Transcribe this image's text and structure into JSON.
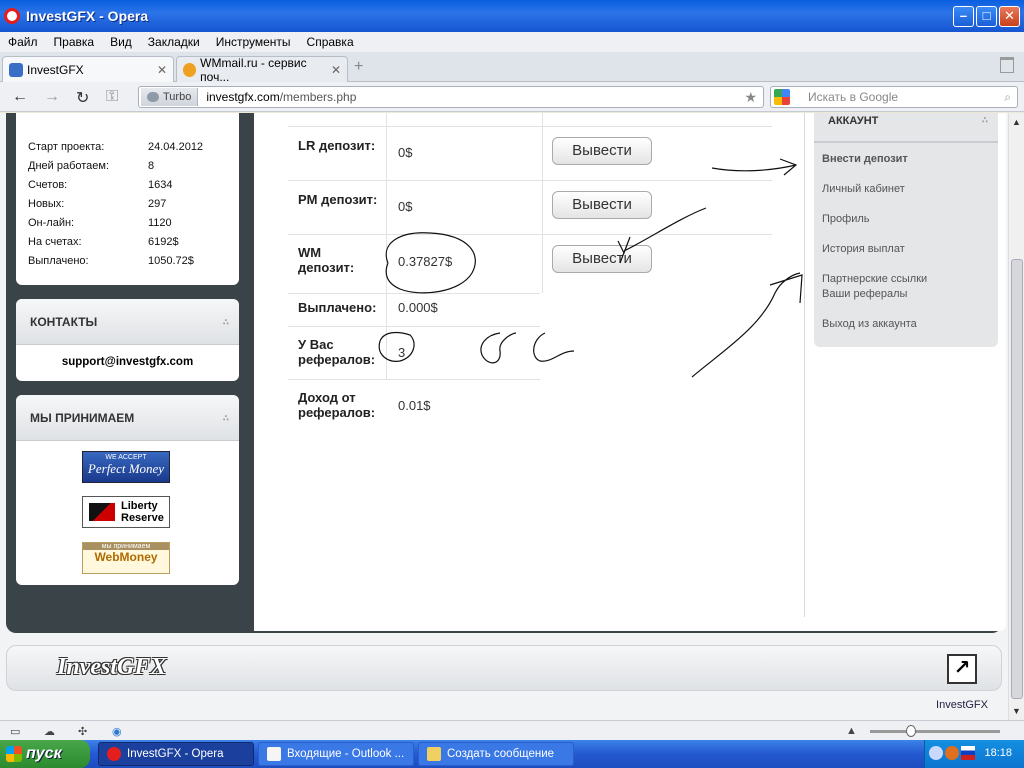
{
  "window": {
    "title": "InvestGFX - Opera"
  },
  "menu": [
    "Файл",
    "Правка",
    "Вид",
    "Закладки",
    "Инструменты",
    "Справка"
  ],
  "tabs": [
    {
      "label": "InvestGFX",
      "active": true
    },
    {
      "label": "WMmail.ru - сервис поч...",
      "active": false
    }
  ],
  "address": {
    "turbo": "Turbo",
    "domain": "investgfx.com",
    "path": "/members.php"
  },
  "search": {
    "placeholder": "Искать в Google"
  },
  "stats": [
    {
      "k": "Старт проекта:",
      "v": "24.04.2012"
    },
    {
      "k": "Дней работаем:",
      "v": "8"
    },
    {
      "k": "Счетов:",
      "v": "1634"
    },
    {
      "k": "Новых:",
      "v": "297"
    },
    {
      "k": "Он-лайн:",
      "v": "1120"
    },
    {
      "k": "На счетах:",
      "v": "6192$"
    },
    {
      "k": "Выплачено:",
      "v": "1050.72$"
    }
  ],
  "contacts": {
    "title": "КОНТАКТЫ",
    "email": "support@investgfx.com"
  },
  "accept": {
    "title": "МЫ ПРИНИМАЕМ",
    "pm_small": "WE ACCEPT",
    "pm": "Perfect Money",
    "lr": "Liberty Reserve",
    "wm_small": "мы принимаем",
    "wm": "WebMoney"
  },
  "account": {
    "rows": [
      {
        "label": "LR депозит:",
        "value": "0$",
        "button": "Вывести"
      },
      {
        "label": "PM депозит:",
        "value": "0$",
        "button": "Вывести"
      },
      {
        "label": "WM депозит:",
        "value": "0.37827$",
        "button": "Вывести"
      },
      {
        "label": "Выплачено:",
        "value": "0.000$"
      },
      {
        "label": "У Вас рефералов:",
        "value": "3"
      },
      {
        "label": "Доход от рефералов:",
        "value": "0.01$"
      }
    ]
  },
  "sidemenu": {
    "title": "АККАУНТ",
    "items": [
      "Внести депозит",
      "Личный кабинет",
      "Профиль",
      "История выплат",
      "Партнерские ссылки Ваши рефералы",
      "Выход из аккаунта"
    ]
  },
  "footer": {
    "brand": "InvestGFX",
    "text": "InvestGFX",
    "up_icon": "arrow-up-right-icon"
  },
  "taskbar": {
    "start": "пуск",
    "tasks": [
      "InvestGFX - Opera",
      "Входящие - Outlook ...",
      "Создать сообщение"
    ],
    "clock": "18:18"
  }
}
